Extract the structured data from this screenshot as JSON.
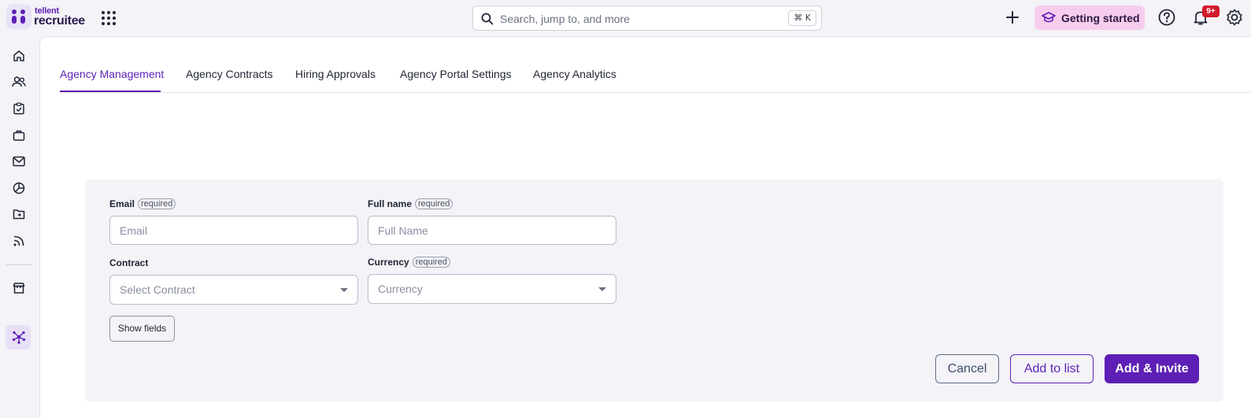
{
  "brand": {
    "small": "tellent",
    "big": "recruitee"
  },
  "search": {
    "placeholder": "Search, jump to, and more",
    "shortcut": "⌘ K"
  },
  "header": {
    "getting_started": "Getting started",
    "notification_count": "9+"
  },
  "sidebar": {
    "items": [
      {
        "icon": "home-icon"
      },
      {
        "icon": "people-icon"
      },
      {
        "icon": "clipboard-check-icon"
      },
      {
        "icon": "briefcase-icon"
      },
      {
        "icon": "mail-icon"
      },
      {
        "icon": "pie-chart-icon"
      },
      {
        "icon": "folder-icon"
      },
      {
        "icon": "rss-icon"
      },
      {
        "icon": "store-icon"
      },
      {
        "icon": "network-icon",
        "active": true
      }
    ]
  },
  "tabs": [
    {
      "label": "Agency Management",
      "active": true
    },
    {
      "label": "Agency Contracts"
    },
    {
      "label": "Hiring Approvals"
    },
    {
      "label": "Agency Portal Settings"
    },
    {
      "label": "Agency Analytics"
    }
  ],
  "form": {
    "required_tag": "required",
    "email": {
      "label": "Email",
      "placeholder": "Email"
    },
    "full_name": {
      "label": "Full name",
      "placeholder": "Full Name"
    },
    "contract": {
      "label": "Contract",
      "placeholder": "Select Contract"
    },
    "currency": {
      "label": "Currency",
      "placeholder": "Currency"
    },
    "show_fields": "Show fields",
    "cancel": "Cancel",
    "add_to_list": "Add to list",
    "add_invite": "Add & Invite"
  },
  "colors": {
    "accent": "#5d1fb5",
    "badge": "#d3182b",
    "getting_started_bg": "#f7cdee"
  }
}
